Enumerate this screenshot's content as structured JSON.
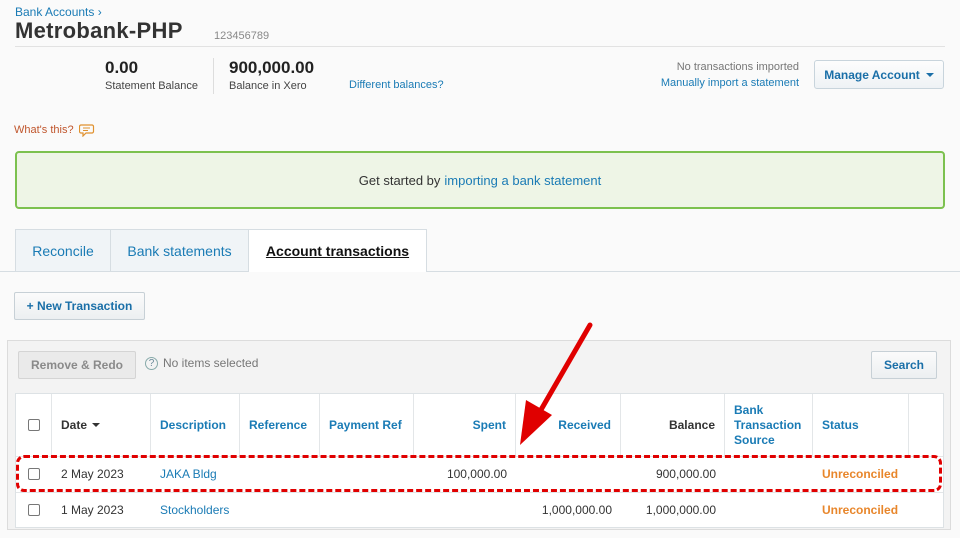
{
  "breadcrumb": "Bank Accounts ›",
  "account": {
    "name": "Metrobank-PHP",
    "number": "123456789"
  },
  "stats": {
    "statement_balance": "0.00",
    "statement_label": "Statement Balance",
    "xero_balance": "900,000.00",
    "xero_label": "Balance in Xero",
    "different_link": "Different balances?"
  },
  "import": {
    "status": "No transactions imported",
    "manual_link": "Manually import a statement"
  },
  "manage_button": "Manage Account",
  "whats_this": "What's this?",
  "banner": {
    "text": "Get started by",
    "link": "importing a bank statement"
  },
  "tabs": [
    {
      "label": "Reconcile"
    },
    {
      "label": "Bank statements"
    },
    {
      "label": "Account transactions",
      "active": true
    }
  ],
  "new_transaction": "+ New Transaction",
  "toolbar": {
    "remove_redo": "Remove & Redo",
    "no_items": "No items selected",
    "search": "Search",
    "help_glyph": "?"
  },
  "table": {
    "columns": {
      "date": "Date",
      "description": "Description",
      "reference": "Reference",
      "payment_ref": "Payment Ref",
      "spent": "Spent",
      "received": "Received",
      "balance": "Balance",
      "source_1": "Bank",
      "source_2": "Transaction",
      "source_3": "Source",
      "status": "Status"
    },
    "rows": [
      {
        "date": "2 May 2023",
        "description": "JAKA Bldg",
        "reference": "",
        "payment_ref": "",
        "spent": "100,000.00",
        "received": "",
        "balance": "900,000.00",
        "source": "",
        "status": "Unreconciled"
      },
      {
        "date": "1 May 2023",
        "description": "Stockholders",
        "reference": "",
        "payment_ref": "",
        "spent": "",
        "received": "1,000,000.00",
        "balance": "1,000,000.00",
        "source": "",
        "status": "Unreconciled"
      }
    ]
  },
  "colors": {
    "link": "#1a7bb5",
    "accent_green": "#7cc14f",
    "status_orange": "#e8862b",
    "annotation_red": "#e00000"
  }
}
